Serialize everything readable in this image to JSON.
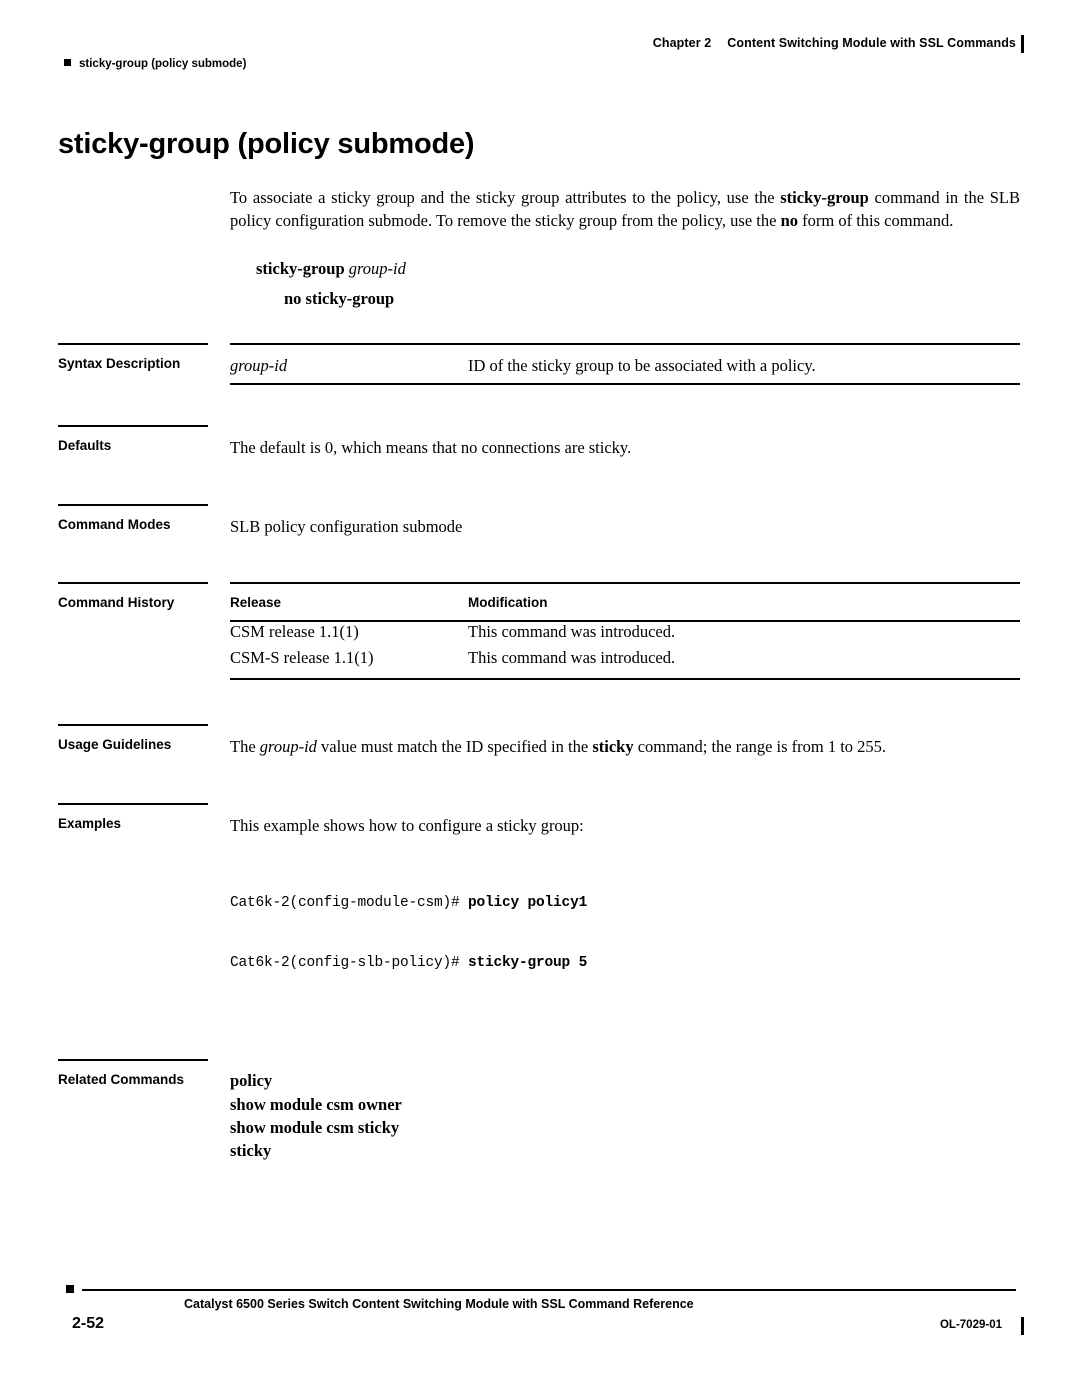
{
  "header": {
    "chapter_label": "Chapter 2",
    "chapter_title": "Content Switching Module with SSL Commands",
    "running_head": "sticky-group (policy submode)"
  },
  "title": "sticky-group (policy submode)",
  "intro": {
    "part1": "To associate a sticky group and the sticky group attributes to the policy, use the ",
    "cmd1": "sticky-group",
    "part2": " command in the SLB policy configuration submode. To remove the sticky group from the policy, use the ",
    "cmd2": "no",
    "part3": " form of this command."
  },
  "syntax": {
    "command": "sticky-group",
    "argument": "group-id",
    "no_form": "no sticky-group"
  },
  "sections": {
    "syntax_description": {
      "label": "Syntax Description",
      "arg": "group-id",
      "desc": "ID of the sticky group to be associated with a policy."
    },
    "defaults": {
      "label": "Defaults",
      "text": "The default is 0, which means that no connections are sticky."
    },
    "command_modes": {
      "label": "Command Modes",
      "text": "SLB policy configuration submode"
    },
    "command_history": {
      "label": "Command History",
      "col_release": "Release",
      "col_modification": "Modification",
      "rows": [
        {
          "release": "CSM release 1.1(1)",
          "modification": "This command was introduced."
        },
        {
          "release": "CSM-S release 1.1(1)",
          "modification": "This command was introduced."
        }
      ]
    },
    "usage_guidelines": {
      "label": "Usage Guidelines",
      "t1": "The ",
      "arg": "group-id",
      "t2": " value must match the ID specified in the ",
      "cmd": "sticky",
      "t3": " command; the range is from 1 to 255."
    },
    "examples": {
      "label": "Examples",
      "text": "This example shows how to configure a sticky group:",
      "code_lines": [
        {
          "prompt": "Cat6k-2(config-module-csm)# ",
          "command": "policy policy1"
        },
        {
          "prompt": "Cat6k-2(config-slb-policy)# ",
          "command": "sticky-group 5"
        }
      ]
    },
    "related_commands": {
      "label": "Related Commands",
      "items": [
        "policy",
        "show module csm owner",
        "show module csm sticky",
        "sticky"
      ]
    }
  },
  "footer": {
    "title": "Catalyst 6500 Series Switch Content Switching Module with SSL Command Reference",
    "page": "2-52",
    "doc_id": "OL-7029-01"
  }
}
